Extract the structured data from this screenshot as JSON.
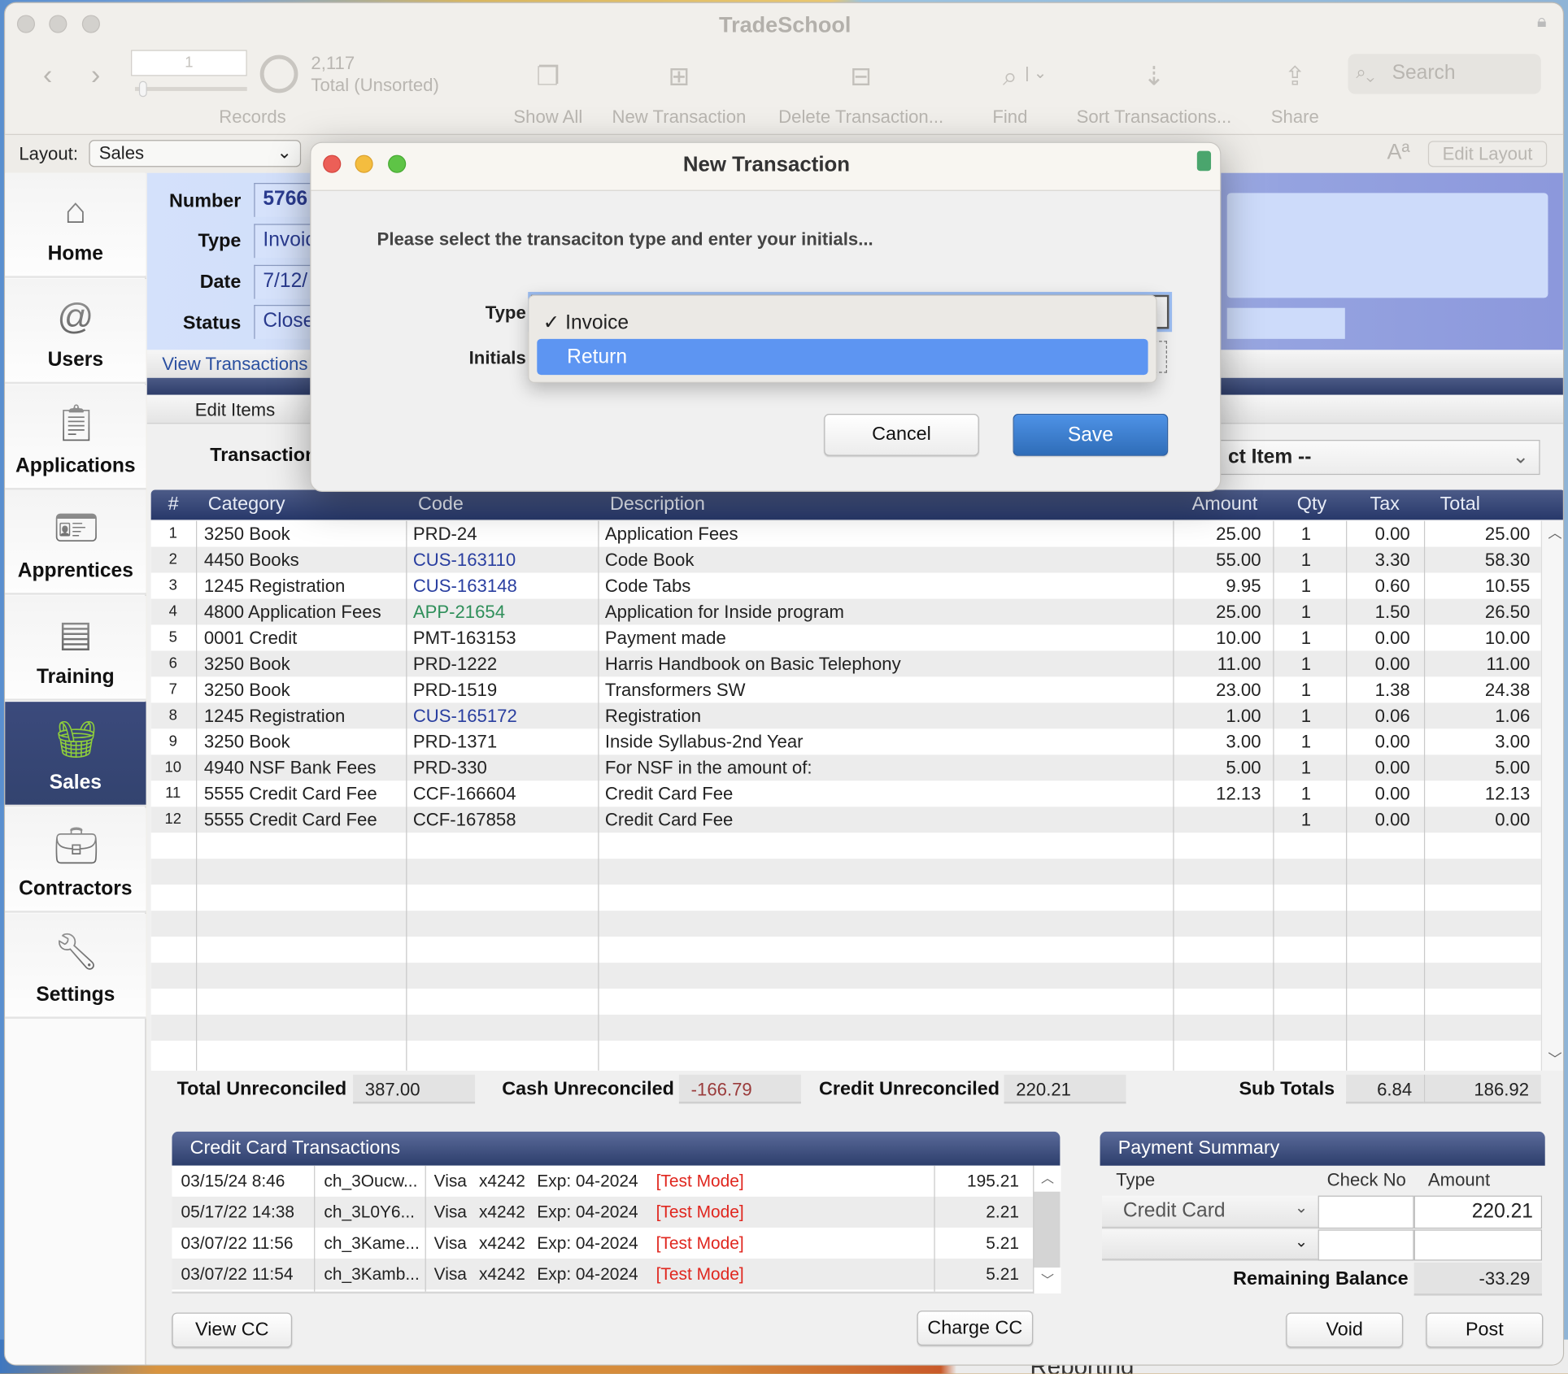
{
  "window": {
    "title": "TradeSchool"
  },
  "toolbar": {
    "record_current": "1",
    "record_total": "2,117",
    "record_sort": "Total (Unsorted)",
    "records_label": "Records",
    "buttons": [
      {
        "label": "Show All",
        "icon": "show-all-icon"
      },
      {
        "label": "New Transaction",
        "icon": "plus-icon"
      },
      {
        "label": "Delete Transaction...",
        "icon": "minus-icon"
      },
      {
        "label": "Find",
        "icon": "magnifier-icon"
      },
      {
        "label": "Sort Transactions...",
        "icon": "sort-az-icon"
      },
      {
        "label": "Share",
        "icon": "share-icon"
      }
    ],
    "search_placeholder": "Search"
  },
  "layout_bar": {
    "label": "Layout:",
    "value": "Sales",
    "font_size_icon": "Aª",
    "edit_layout": "Edit Layout"
  },
  "sidebar": {
    "items": [
      {
        "label": "Home",
        "icon": "house-icon"
      },
      {
        "label": "Users",
        "icon": "address-book-icon"
      },
      {
        "label": "Applications",
        "icon": "clipboard-icon"
      },
      {
        "label": "Apprentices",
        "icon": "id-badge-icon"
      },
      {
        "label": "Training",
        "icon": "certificate-icon"
      },
      {
        "label": "Sales",
        "icon": "basket-icon",
        "selected": true
      },
      {
        "label": "Contractors",
        "icon": "briefcase-icon"
      },
      {
        "label": "Settings",
        "icon": "wrench-icon"
      }
    ]
  },
  "record": {
    "number_label": "Number",
    "number": "5766",
    "type_label": "Type",
    "type": "Invoic",
    "date_label": "Date",
    "date": "7/12/",
    "status_label": "Status",
    "status": "Close"
  },
  "tabs": {
    "view_transactions": "View Transactions",
    "edit_items": "Edit Items"
  },
  "transaction_label": "Transaction",
  "select_item": "ct Item --",
  "items_table": {
    "columns": [
      "#",
      "Category",
      "Code",
      "Description",
      "Amount",
      "Qty",
      "Tax",
      "Total"
    ],
    "rows": [
      {
        "n": "1",
        "category": "3250 Book",
        "code": "PRD-24",
        "desc": "Application Fees",
        "amount": "25.00",
        "qty": "1",
        "tax": "0.00",
        "total": "25.00"
      },
      {
        "n": "2",
        "category": "4450 Books",
        "code": "CUS-163110",
        "code_color": "#2a3fa0",
        "desc": "Code Book",
        "amount": "55.00",
        "qty": "1",
        "tax": "3.30",
        "total": "58.30"
      },
      {
        "n": "3",
        "category": "1245 Registration",
        "code": "CUS-163148",
        "code_color": "#2a3fa0",
        "desc": "Code Tabs",
        "amount": "9.95",
        "qty": "1",
        "tax": "0.60",
        "total": "10.55"
      },
      {
        "n": "4",
        "category": "4800 Application Fees",
        "code": "APP-21654",
        "code_color": "#2f8f5a",
        "desc": "Application for Inside program",
        "amount": "25.00",
        "qty": "1",
        "tax": "1.50",
        "total": "26.50"
      },
      {
        "n": "5",
        "category": "0001 Credit",
        "code": "PMT-163153",
        "desc": "Payment made",
        "amount": "10.00",
        "qty": "1",
        "tax": "0.00",
        "total": "10.00"
      },
      {
        "n": "6",
        "category": "3250 Book",
        "code": "PRD-1222",
        "desc": "Harris Handbook on Basic Telephony",
        "amount": "11.00",
        "qty": "1",
        "tax": "0.00",
        "total": "11.00"
      },
      {
        "n": "7",
        "category": "3250 Book",
        "code": "PRD-1519",
        "desc": "Transformers SW",
        "amount": "23.00",
        "qty": "1",
        "tax": "1.38",
        "total": "24.38"
      },
      {
        "n": "8",
        "category": "1245 Registration",
        "code": "CUS-165172",
        "code_color": "#2a3fa0",
        "desc": "Registration",
        "amount": "1.00",
        "qty": "1",
        "tax": "0.06",
        "total": "1.06"
      },
      {
        "n": "9",
        "category": "3250 Book",
        "code": "PRD-1371",
        "desc": "Inside Syllabus-2nd Year",
        "amount": "3.00",
        "qty": "1",
        "tax": "0.00",
        "total": "3.00"
      },
      {
        "n": "10",
        "category": "4940 NSF Bank Fees",
        "code": "PRD-330",
        "desc": "For NSF in the amount of:",
        "amount": "5.00",
        "qty": "1",
        "tax": "0.00",
        "total": "5.00"
      },
      {
        "n": "11",
        "category": "5555 Credit Card Fee",
        "code": "CCF-166604",
        "desc": "Credit Card Fee",
        "amount": "12.13",
        "qty": "1",
        "tax": "0.00",
        "total": "12.13"
      },
      {
        "n": "12",
        "category": "5555 Credit Card Fee",
        "code": "CCF-167858",
        "desc": "Credit Card Fee",
        "amount": "",
        "qty": "1",
        "tax": "0.00",
        "total": "0.00"
      }
    ]
  },
  "totals": {
    "total_unreconciled_label": "Total Unreconciled",
    "total_unreconciled": "387.00",
    "cash_unreconciled_label": "Cash Unreconciled",
    "cash_unreconciled": "-166.79",
    "credit_unreconciled_label": "Credit Unreconciled",
    "credit_unreconciled": "220.21",
    "sub_totals_label": "Sub Totals",
    "sub_tax": "6.84",
    "sub_total": "186.92"
  },
  "cc_panel": {
    "title": "Credit Card Transactions",
    "rows": [
      {
        "date": "03/15/24 8:46",
        "id": "ch_3Oucw...",
        "brand": "Visa",
        "card": "x4242",
        "exp": "Exp: 04-2024",
        "mode": "[Test Mode]",
        "amount": "195.21"
      },
      {
        "date": "05/17/22 14:38",
        "id": "ch_3L0Y6...",
        "brand": "Visa",
        "card": "x4242",
        "exp": "Exp: 04-2024",
        "mode": "[Test Mode]",
        "amount": "2.21"
      },
      {
        "date": "03/07/22 11:56",
        "id": "ch_3Kame...",
        "brand": "Visa",
        "card": "x4242",
        "exp": "Exp: 04-2024",
        "mode": "[Test Mode]",
        "amount": "5.21"
      },
      {
        "date": "03/07/22 11:54",
        "id": "ch_3Kamb...",
        "brand": "Visa",
        "card": "x4242",
        "exp": "Exp: 04-2024",
        "mode": "[Test Mode]",
        "amount": "5.21"
      }
    ],
    "view_cc": "View CC",
    "charge_cc": "Charge CC"
  },
  "payment": {
    "title": "Payment Summary",
    "col_type": "Type",
    "col_check": "Check No",
    "col_amount": "Amount",
    "row1_type": "Credit Card",
    "row1_amount": "220.21",
    "remaining_label": "Remaining Balance",
    "remaining": "-33.29",
    "void": "Void",
    "post": "Post"
  },
  "background_window": {
    "text": "Reporting"
  },
  "dialog": {
    "title": "New Transaction",
    "prompt": "Please select the transaciton type and enter your initials...",
    "type_label": "Type",
    "initials_label": "Initials",
    "type_options": [
      {
        "label": "Invoice",
        "checked": true
      },
      {
        "label": "Return",
        "highlighted": true
      }
    ],
    "cancel": "Cancel",
    "save": "Save"
  },
  "colors": {
    "accent": "#3a7bd5",
    "menu_highlight": "#5d95f2",
    "navy": "#2d3e6c",
    "test_mode": "#e0261e",
    "negative": "#9a3b3b"
  }
}
